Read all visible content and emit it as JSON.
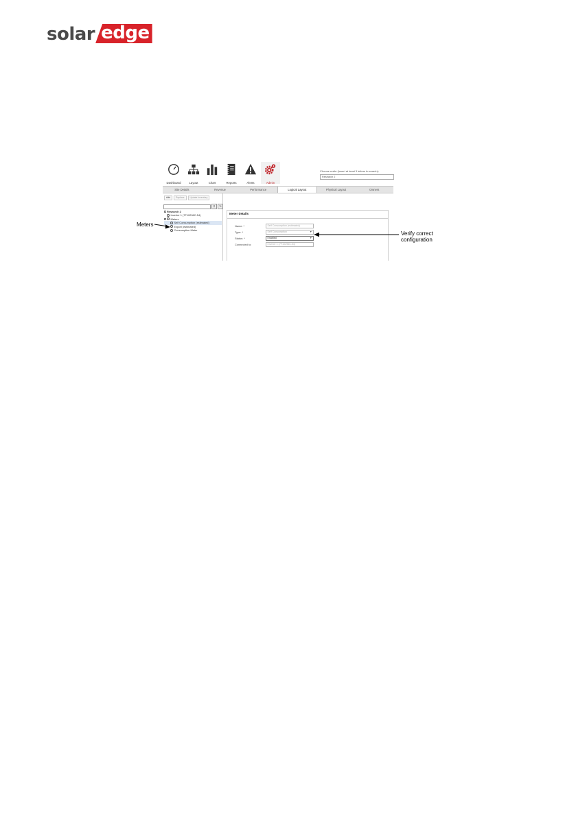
{
  "logo": {
    "solar": "solar",
    "edge": "edge"
  },
  "nav": [
    {
      "label": "Dashboard",
      "icon": "gauge-icon"
    },
    {
      "label": "Layout",
      "icon": "hierarchy-icon"
    },
    {
      "label": "Chart",
      "icon": "bar-chart-icon"
    },
    {
      "label": "Reports",
      "icon": "notebook-icon"
    },
    {
      "label": "Alerts",
      "icon": "warning-icon"
    },
    {
      "label": "Admin",
      "icon": "gear-icon",
      "active": true
    }
  ],
  "site_chooser": {
    "label": "Choose a site (insert at least 3 letters to search):",
    "value": "Research 2"
  },
  "tabs": [
    "Site Details",
    "Revenue",
    "Performance",
    "Logical Layout",
    "Physical Layout",
    "Owners"
  ],
  "active_tab": "Logical Layout",
  "toolbar": {
    "add": "Add",
    "replace": "Replace",
    "update": "Update Inventory"
  },
  "tree": {
    "site": "Research 2",
    "inverter": "Inverter 1 (7F10296C-54)",
    "meters": "Meters",
    "meter_items": [
      "Self Consumption (estimated)",
      "Export (estimated)",
      "Consumption Meter"
    ]
  },
  "meter_details": {
    "title": "Meter details",
    "name_label": "Name: *",
    "name_value": "Self Consumption (estimated)",
    "type_label": "Type: *",
    "type_value": "Self Consumption",
    "status_label": "Status: *",
    "status_value": "Enabled",
    "connected_label": "Connected to:",
    "connected_value": "Inverter 1 (7F10296C-54)"
  },
  "callouts": {
    "meters": "Meters",
    "verify_line1": "Verify correct",
    "verify_line2": "configuration"
  }
}
